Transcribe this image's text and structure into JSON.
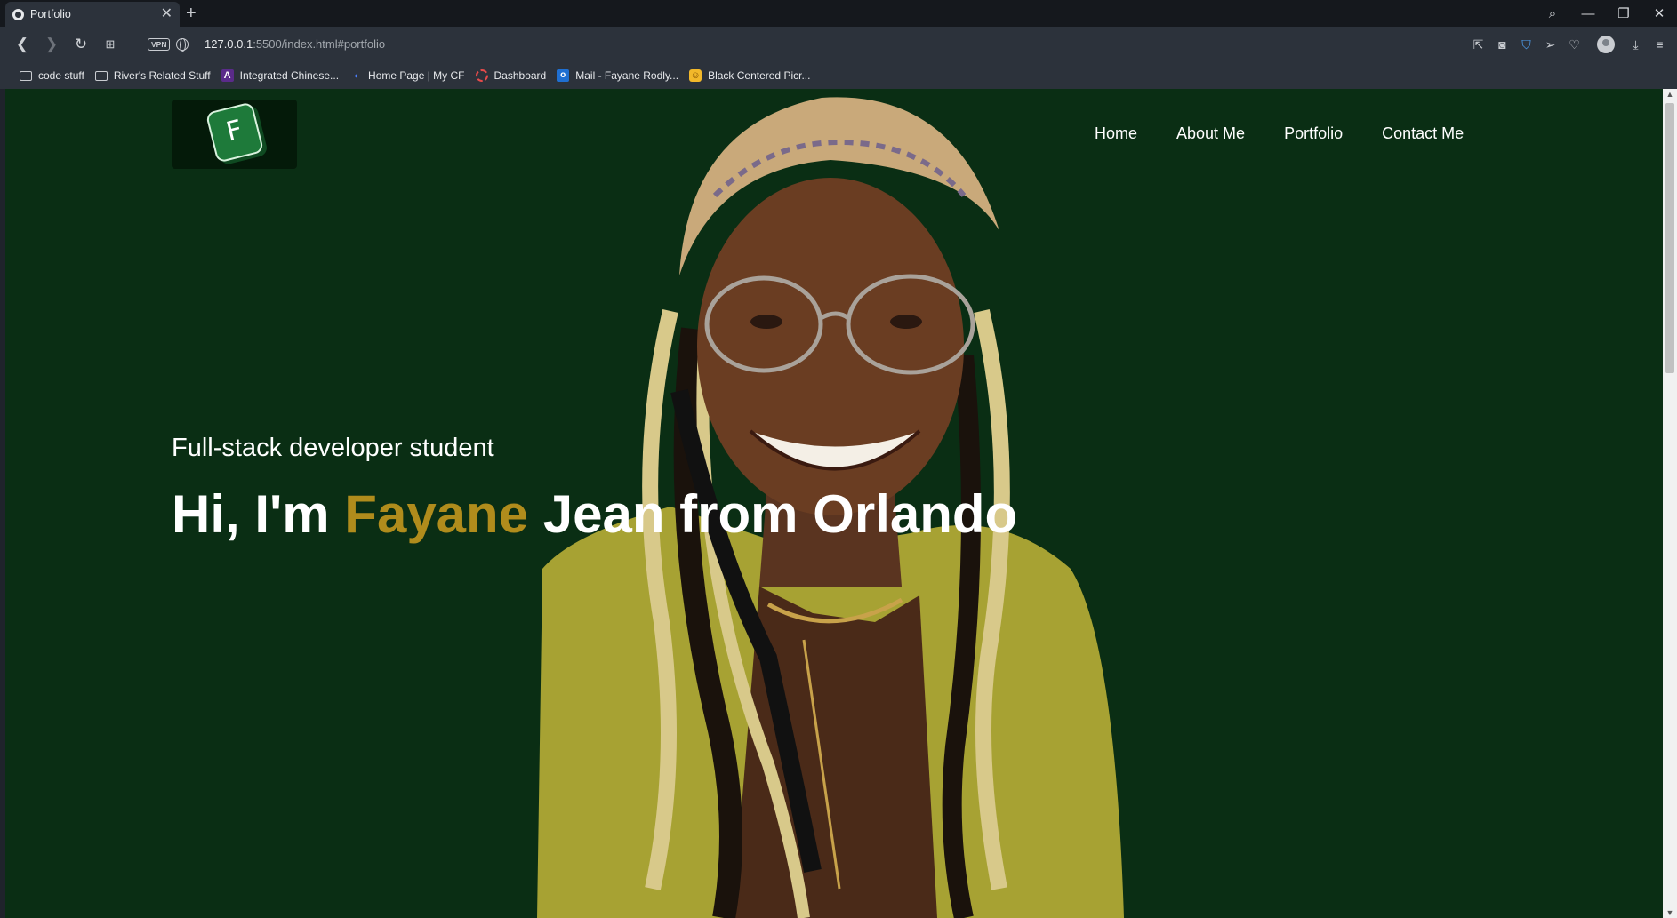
{
  "browser": {
    "tab_title": "Portfolio",
    "url_host": "127.0.0.1",
    "url_rest": ":5500/index.html#portfolio",
    "vpn_label": "VPN"
  },
  "bookmarks": [
    {
      "label": "code stuff",
      "icon": "folder-icon"
    },
    {
      "label": "River's Related Stuff",
      "icon": "folder-icon"
    },
    {
      "label": "Integrated Chinese...",
      "icon": "anthology-icon"
    },
    {
      "label": "Home Page | My CF",
      "icon": "cf-icon"
    },
    {
      "label": "Dashboard",
      "icon": "dashboard-icon"
    },
    {
      "label": "Mail - Fayane Rodly...",
      "icon": "outlook-icon"
    },
    {
      "label": "Black Centered Picr...",
      "icon": "picture-icon"
    }
  ],
  "site": {
    "logo_letter": "F",
    "nav": [
      "Home",
      "About Me",
      "Portfolio",
      "Contact Me"
    ],
    "hero_subtitle": "Full-stack developer student",
    "hero_title_pre": "Hi, I'm ",
    "hero_title_name": "Fayane",
    "hero_title_post": " Jean from Orlando"
  },
  "colors": {
    "page_background": "#0a2e14",
    "accent": "#b08c1c",
    "browser_chrome": "#2c323b"
  }
}
